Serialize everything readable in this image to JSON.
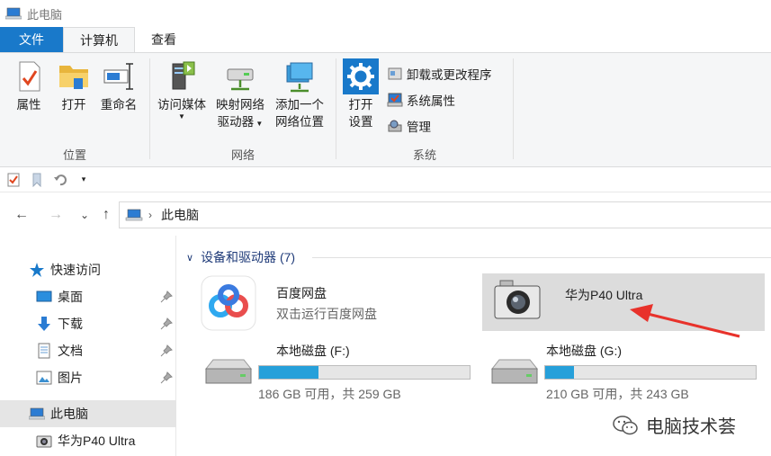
{
  "window": {
    "title": "此电脑"
  },
  "tabs": [
    {
      "label": "文件"
    },
    {
      "label": "计算机"
    },
    {
      "label": "查看"
    }
  ],
  "ribbon": {
    "groups": {
      "location": {
        "label": "位置",
        "buttons": [
          {
            "label": "属性"
          },
          {
            "label": "打开"
          },
          {
            "label": "重命名"
          }
        ]
      },
      "network": {
        "label": "网络",
        "buttons": [
          {
            "label": "访问媒体"
          },
          {
            "label1": "映射网络",
            "label2": "驱动器"
          },
          {
            "label1": "添加一个",
            "label2": "网络位置"
          }
        ]
      },
      "system": {
        "label": "系统",
        "open_settings_1": "打开",
        "open_settings_2": "设置",
        "items": [
          {
            "label": "卸载或更改程序"
          },
          {
            "label": "系统属性"
          },
          {
            "label": "管理"
          }
        ]
      }
    }
  },
  "address": {
    "path": "此电脑"
  },
  "navpane": {
    "items": [
      {
        "label": "快速访问"
      },
      {
        "label": "桌面"
      },
      {
        "label": "下载"
      },
      {
        "label": "文档"
      },
      {
        "label": "图片"
      },
      {
        "label": "此电脑"
      },
      {
        "label": "华为P40 Ultra"
      }
    ]
  },
  "content": {
    "group_header": "设备和驱动器 (7)",
    "tiles": [
      {
        "name": "百度网盘",
        "sub": "双击运行百度网盘"
      },
      {
        "name": "华为P40 Ultra"
      },
      {
        "name": "本地磁盘 (F:)",
        "free": "186 GB 可用，共 259 GB",
        "used_fraction": 0.282
      },
      {
        "name": "本地磁盘 (G:)",
        "free": "210 GB 可用，共 243 GB",
        "used_fraction": 0.136
      }
    ]
  },
  "watermark": {
    "text": "电脑技术荟"
  },
  "colors": {
    "accent": "#1979ca",
    "bar_fill": "#26a0da",
    "arrow": "#e8322b"
  }
}
